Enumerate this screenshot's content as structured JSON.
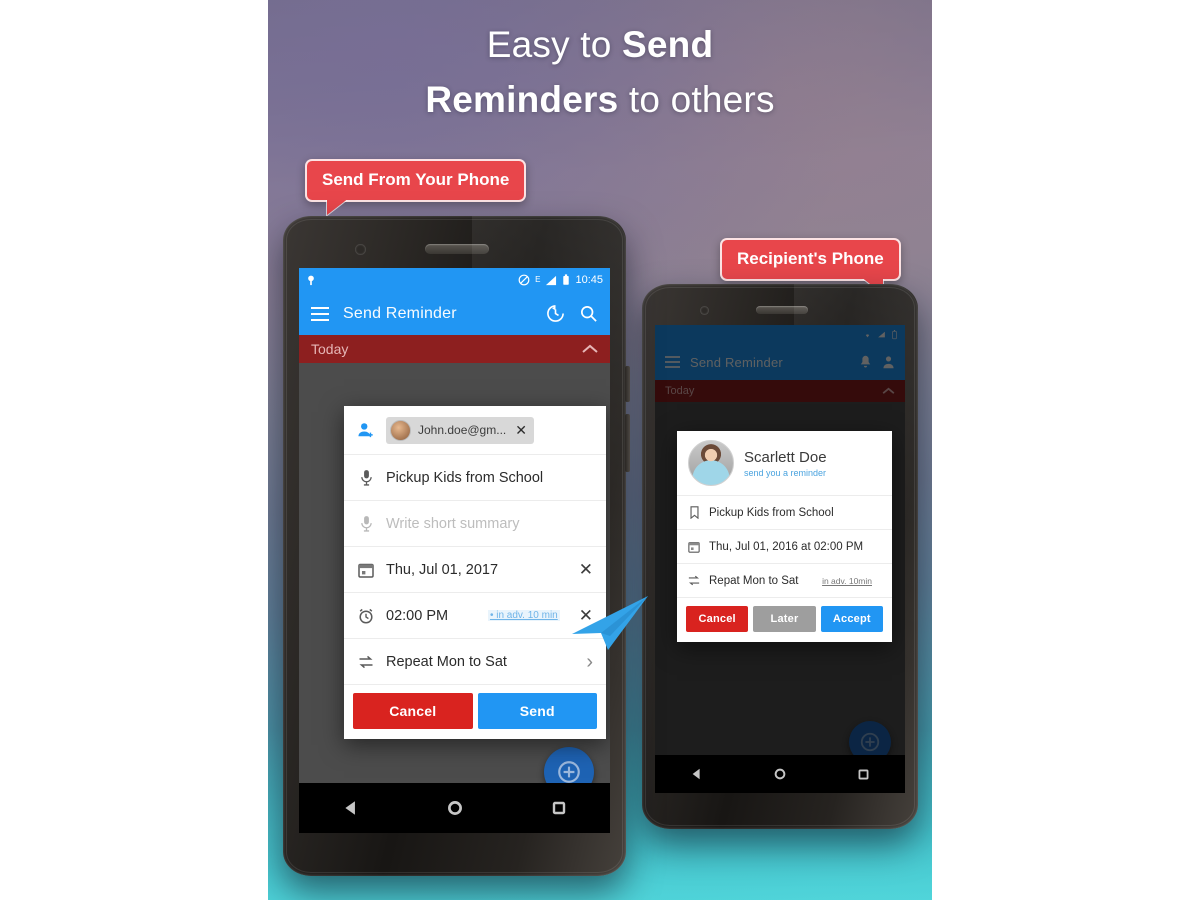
{
  "headline": {
    "line1_plain": "Easy to ",
    "line1_bold": "Send",
    "line2_bold": "Reminders",
    "line2_plain": " to others"
  },
  "callouts": {
    "left": "Send From Your Phone",
    "right": "Recipient's Phone"
  },
  "colors": {
    "accent_blue": "#2196f3",
    "callout_red": "#e8464b",
    "cancel_red": "#d9231f",
    "later_grey": "#9e9e9e",
    "today_band": "#8d1f1f",
    "link_blue": "#6fb4e8"
  },
  "sender_phone": {
    "statusbar": {
      "time": "10:45",
      "icons": [
        "notification-dot-icon",
        "do-not-disturb-icon",
        "edge-network-icon",
        "signal-icon",
        "battery-icon"
      ]
    },
    "appbar": {
      "menu_icon": "hamburger-menu-icon",
      "title": "Send Reminder",
      "history_icon": "history-icon",
      "search_icon": "search-icon"
    },
    "section_band": {
      "label": "Today",
      "chevron": "chevron-up-icon"
    },
    "fab_icon": "add-circle-icon",
    "dialog": {
      "contact_chip": {
        "person_icon": "add-person-icon",
        "avatar": "contact-avatar",
        "name": "John.doe@gm...",
        "remove": "✕"
      },
      "rows": [
        {
          "icon": "mic-icon",
          "text": "Pickup Kids from School",
          "muted": false,
          "trailing": ""
        },
        {
          "icon": "mic-icon",
          "text": "Write short summary",
          "muted": true,
          "trailing": ""
        },
        {
          "icon": "calendar-icon",
          "text": "Thu, Jul 01, 2017",
          "muted": false,
          "trailing": "✕"
        },
        {
          "icon": "alarm-icon",
          "text": "02:00 PM",
          "muted": false,
          "trailing": "✕",
          "link": "• in adv. 10 min"
        },
        {
          "icon": "repeat-icon",
          "text": "Repeat Mon to Sat",
          "muted": false,
          "trailing": "›"
        }
      ],
      "buttons": {
        "cancel": "Cancel",
        "send": "Send"
      }
    },
    "navbar": [
      "back-icon",
      "home-icon",
      "recents-icon"
    ]
  },
  "recipient_phone": {
    "appbar": {
      "menu_icon": "hamburger-menu-icon",
      "title": "Send Reminder",
      "bell_icon": "notification-bell-icon",
      "profile_icon": "profile-icon"
    },
    "section_band": {
      "label": "Today",
      "chevron": "chevron-up-icon"
    },
    "fab_icon": "add-circle-icon",
    "dialog": {
      "header": {
        "avatar": "sender-photo",
        "name": "Scarlett Doe",
        "subtitle": "send you a reminder"
      },
      "rows": [
        {
          "icon": "bookmark-icon",
          "text": "Pickup Kids from School",
          "trailing": ""
        },
        {
          "icon": "calendar-icon",
          "text": "Thu, Jul 01, 2016 at 02:00 PM",
          "trailing": ""
        },
        {
          "icon": "repeat-icon",
          "text": "Repat Mon to Sat",
          "link": "in adv. 10min",
          "trailing": ""
        }
      ],
      "buttons": {
        "cancel": "Cancel",
        "later": "Later",
        "accept": "Accept"
      }
    },
    "navbar": [
      "back-icon",
      "home-icon",
      "recents-icon"
    ]
  },
  "decor": {
    "send_arrow_icon": "paper-plane-icon"
  }
}
